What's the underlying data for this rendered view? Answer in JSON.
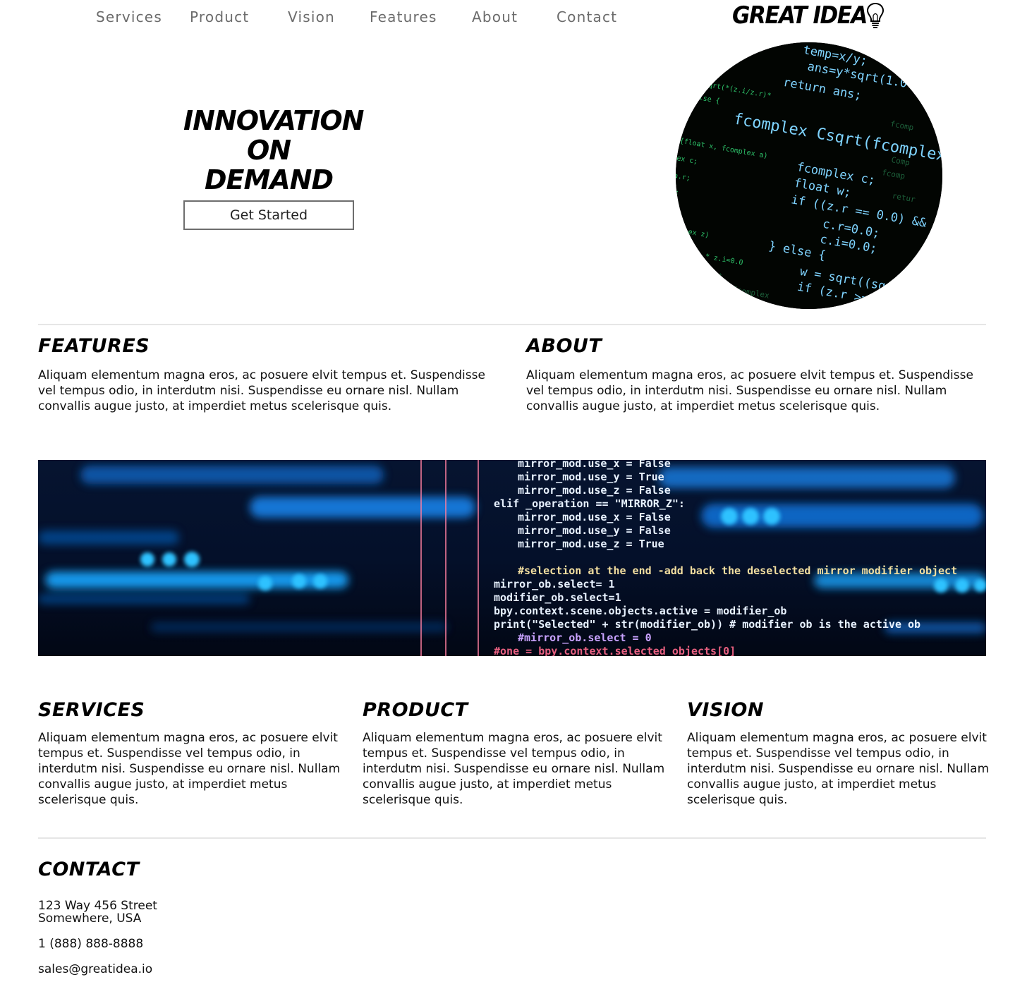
{
  "nav": {
    "items": [
      "Services",
      "Product",
      "Vision",
      "Features",
      "About",
      "Contact"
    ]
  },
  "logo": {
    "text": "GREAT IDEA",
    "icon": "lightbulb-icon"
  },
  "hero": {
    "title_lines": [
      "INNOVATION",
      "ON",
      "DEMAND"
    ],
    "cta_label": "Get Started",
    "image_icon": "code-screen-image"
  },
  "features": {
    "title": "Features",
    "text": "Aliquam elementum magna eros, ac posuere elvit tempus et. Suspendisse vel tempus odio, in interdutm nisi. Suspendisse eu ornare nisl. Nullam convallis augue justo, at imperdiet metus scelerisque quis."
  },
  "about": {
    "title": "About",
    "text": "Aliquam elementum magna eros, ac posuere elvit tempus et. Suspendisse vel tempus odio, in interdutm nisi. Suspendisse eu ornare nisl. Nullam convallis augue justo, at imperdiet metus scelerisque quis."
  },
  "banner": {
    "code_lines": [
      "mirror_mod.use_x = False",
      "mirror_mod.use_y = True",
      "mirror_mod.use_z = False",
      "elif _operation == \"MIRROR_Z\":",
      "mirror_mod.use_x = False",
      "mirror_mod.use_y = False",
      "mirror_mod.use_z = True",
      "#selection at the end -add back the deselected mirror modifier object",
      "mirror_ob.select= 1",
      "modifier_ob.select=1",
      "bpy.context.scene.objects.active = modifier_ob",
      "print(\"Selected\" + str(modifier_ob)) # modifier ob is the active ob",
      "#mirror_ob.select = 0",
      "#one = bpy.context.selected_objects[0]"
    ]
  },
  "services": {
    "title": "Services",
    "text": "Aliquam elementum magna eros, ac posuere elvit tempus et. Suspendisse vel tempus odio, in interdutm nisi. Suspendisse eu ornare nisl. Nullam convallis augue justo, at imperdiet metus scelerisque quis."
  },
  "product": {
    "title": "Product",
    "text": "Aliquam elementum magna eros, ac posuere elvit tempus et. Suspendisse vel tempus odio, in interdutm nisi. Suspendisse eu ornare nisl. Nullam convallis augue justo, at imperdiet metus scelerisque quis."
  },
  "vision": {
    "title": "Vision",
    "text": "Aliquam elementum magna eros, ac posuere elvit tempus et. Suspendisse vel tempus odio, in interdutm nisi. Suspendisse eu ornare nisl. Nullam convallis augue justo, at imperdiet metus scelerisque quis."
  },
  "contact": {
    "title": "Contact",
    "address_line1": "123 Way 456 Street",
    "address_line2": "Somewhere, USA",
    "phone": "1 (888) 888-8888",
    "email": "sales@greatidea.io"
  },
  "colors": {
    "nav_text": "#6b6b6b",
    "rule": "#e6e6e6",
    "code_green": "#35e07a",
    "code_blue": "#5fc4ff",
    "banner_bg": "#040a1c"
  }
}
